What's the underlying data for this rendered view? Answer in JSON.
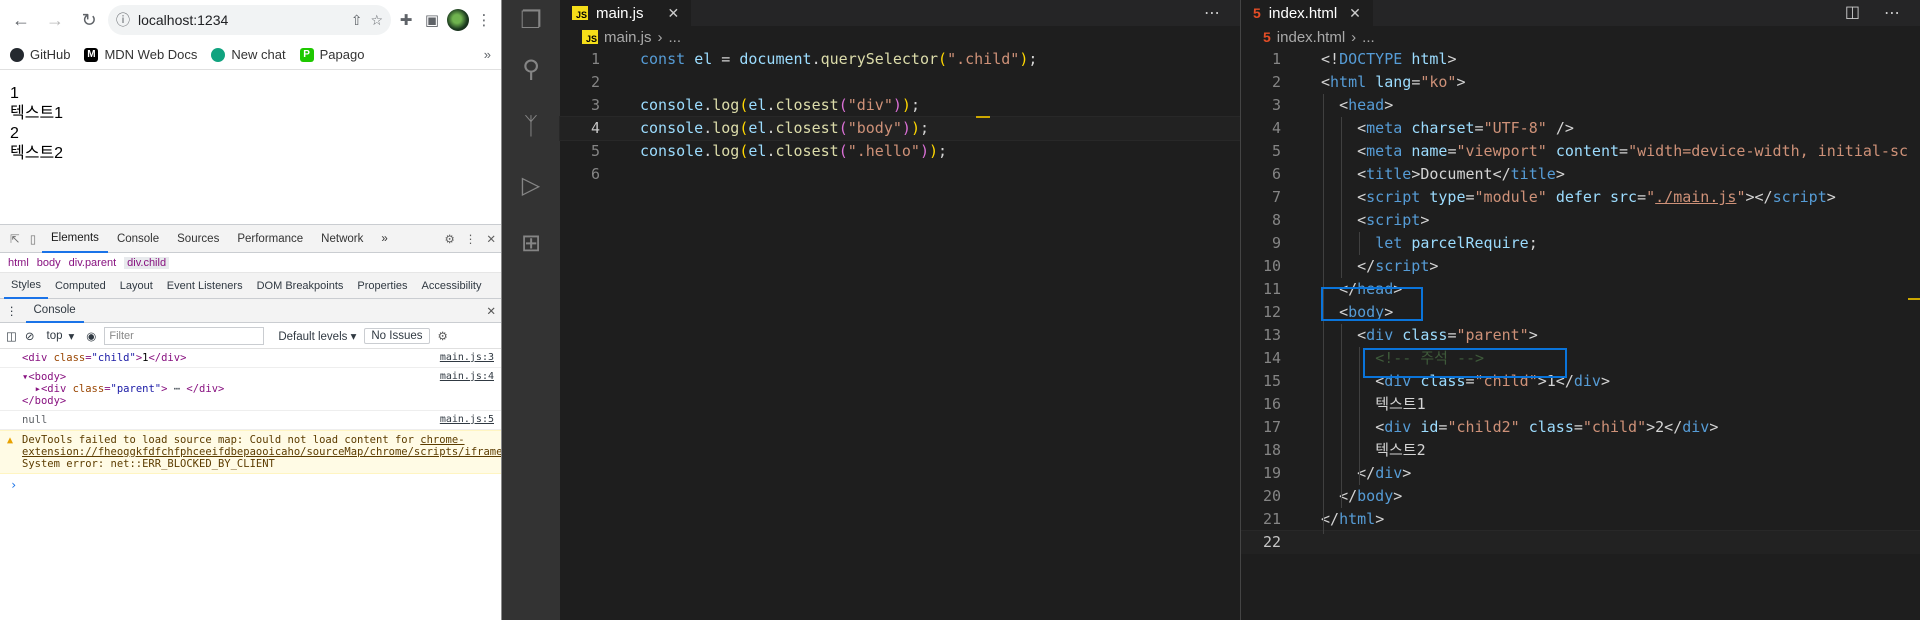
{
  "browser": {
    "url": "localhost:1234",
    "bookmarks": [
      {
        "label": "GitHub",
        "icon": "github-icon"
      },
      {
        "label": "MDN Web Docs",
        "icon": "mdn-icon"
      },
      {
        "label": "New chat",
        "icon": "chatgpt-icon"
      },
      {
        "label": "Papago",
        "icon": "papago-icon"
      }
    ],
    "page_lines": [
      "1",
      "텍스트1",
      "2",
      "텍스트2"
    ],
    "devtools": {
      "tabs": [
        "Elements",
        "Console",
        "Sources",
        "Performance",
        "Network"
      ],
      "selected_tab": "Elements",
      "breadcrumbs": [
        "html",
        "body",
        "div.parent",
        "div.child"
      ],
      "panel_tabs": [
        "Styles",
        "Computed",
        "Layout",
        "Event Listeners",
        "DOM Breakpoints",
        "Properties",
        "Accessibility"
      ],
      "drawer_tab": "Console",
      "context": "top",
      "filter_placeholder": "Filter",
      "levels": "Default levels",
      "issues": "No Issues",
      "messages": {
        "m1_src": "main.js:3",
        "m2_src": "main.js:4",
        "m3_text": "null",
        "m3_src": "main.js:5",
        "warn_prefix": "DevTools failed to load source map: Could not load content for ",
        "warn_link": "chrome-extension://fheoggkfdfchfphceeifdbepaooicaho/sourceMap/chrome/scripts/iframe_form_check.js.map",
        "warn_suffix": ": System error: net::ERR_BLOCKED_BY_CLIENT"
      }
    }
  },
  "editor_left": {
    "tab": "main.js",
    "breadcrumb": [
      "main.js",
      "..."
    ]
  },
  "editor_right": {
    "tab": "index.html",
    "breadcrumb": [
      "index.html",
      "..."
    ]
  },
  "colors": {
    "editor_bg": "#1e1e1e",
    "activity_bg": "#333333",
    "highlight_box": "#0a74da",
    "devtools_accent": "#1a73e8"
  }
}
